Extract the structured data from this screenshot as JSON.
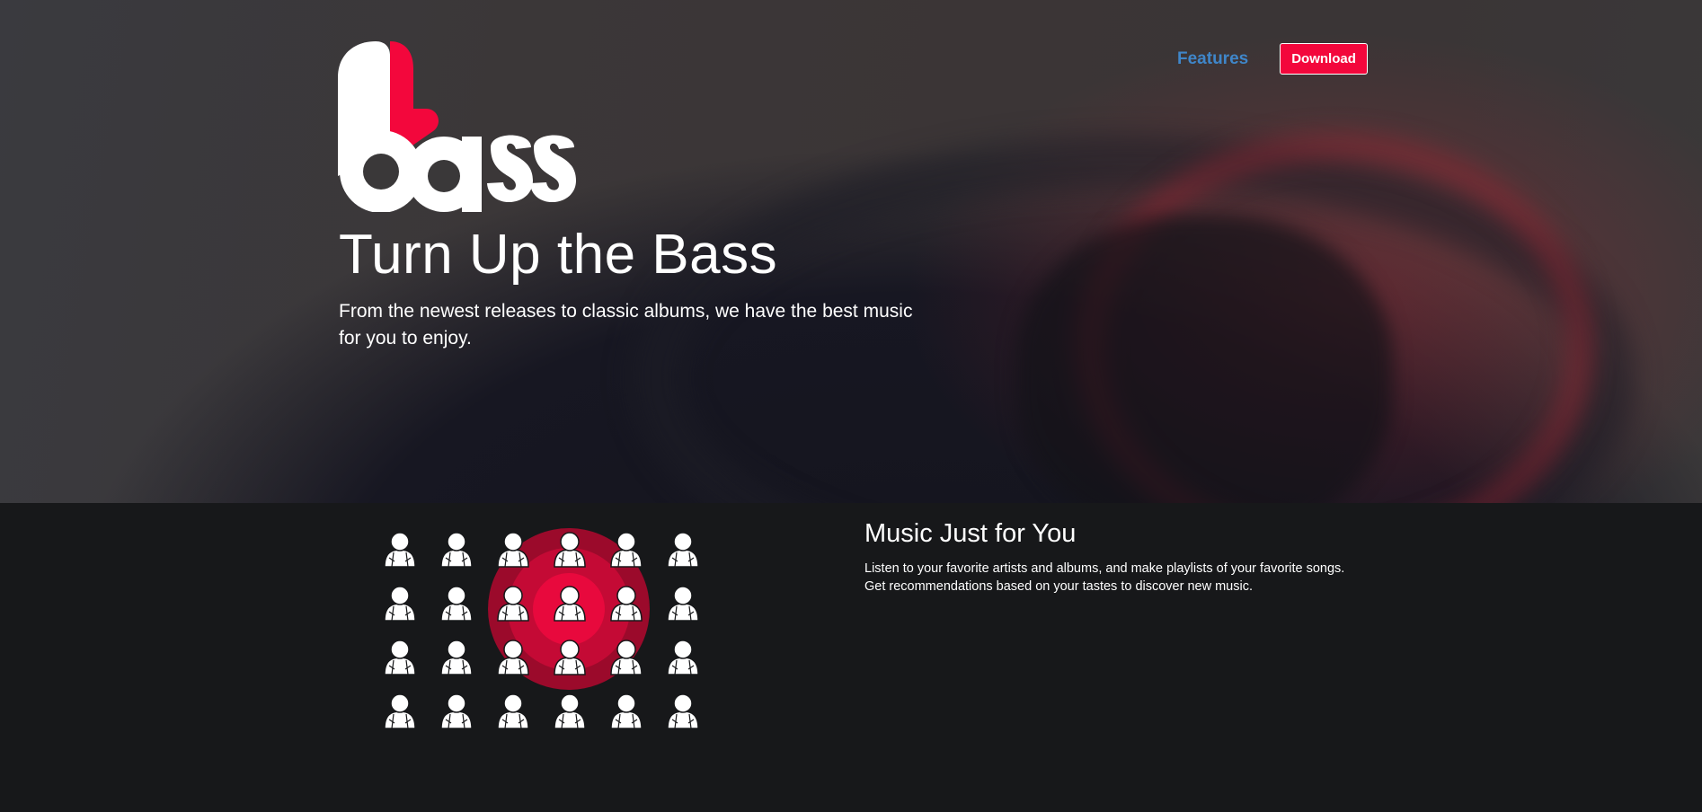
{
  "nav": {
    "features_label": "Features",
    "download_label": "Download"
  },
  "hero": {
    "logo_text": "bass",
    "title": "Turn Up the Bass",
    "subtitle": "From the newest releases to classic albums, we have the best music for you to enjoy."
  },
  "feature": {
    "title": "Music Just for You",
    "text": "Listen to your favorite artists and albums, and make playlists of your favorite songs. Get recommendations based on your tastes to discover new music.",
    "illustration_icon": "person-icon"
  },
  "colors": {
    "accent": "#f3073c",
    "link": "#3f86c9",
    "background": "#17181a"
  }
}
